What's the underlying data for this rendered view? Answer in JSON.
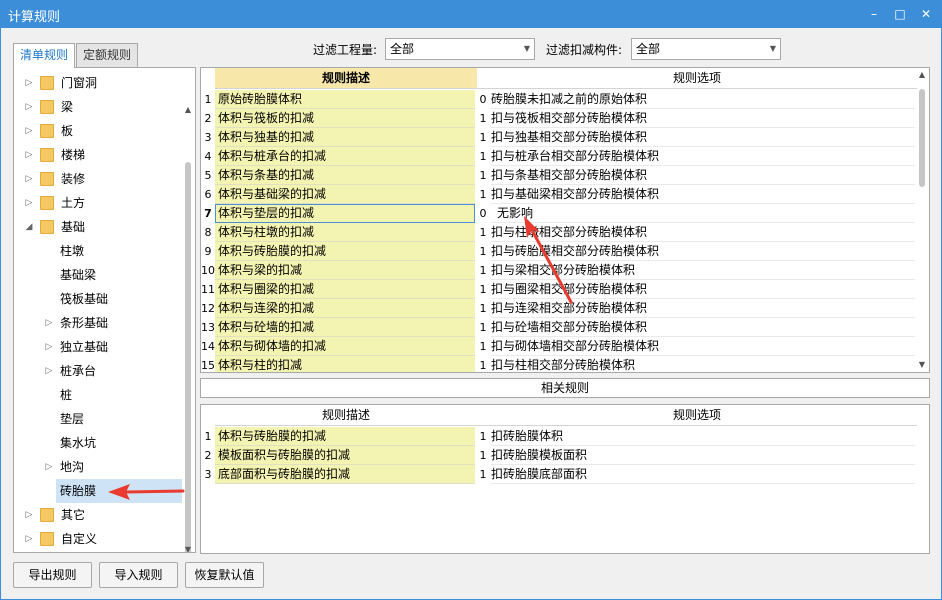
{
  "window": {
    "title": "计算规则",
    "minimize": "–",
    "maximize": "□",
    "close": "✕"
  },
  "tabs": [
    {
      "label": "清单规则"
    },
    {
      "label": "定额规则"
    }
  ],
  "tree": [
    {
      "label": "门窗洞",
      "caret": "▷",
      "folder": true
    },
    {
      "label": "梁",
      "caret": "▷",
      "folder": true
    },
    {
      "label": "板",
      "caret": "▷",
      "folder": true
    },
    {
      "label": "楼梯",
      "caret": "▷",
      "folder": true
    },
    {
      "label": "装修",
      "caret": "▷",
      "folder": true
    },
    {
      "label": "土方",
      "caret": "▷",
      "folder": true
    },
    {
      "label": "基础",
      "caret": "◢",
      "folder": true
    },
    {
      "label": "柱墩",
      "caret": "",
      "folder": false
    },
    {
      "label": "基础梁",
      "caret": "",
      "folder": false
    },
    {
      "label": "筏板基础",
      "caret": "",
      "folder": false
    },
    {
      "label": "条形基础",
      "caret": "▷",
      "folder": false
    },
    {
      "label": "独立基础",
      "caret": "▷",
      "folder": false
    },
    {
      "label": "桩承台",
      "caret": "▷",
      "folder": false
    },
    {
      "label": "桩",
      "caret": "",
      "folder": false
    },
    {
      "label": "垫层",
      "caret": "",
      "folder": false
    },
    {
      "label": "集水坑",
      "caret": "",
      "folder": false
    },
    {
      "label": "地沟",
      "caret": "▷",
      "folder": false
    },
    {
      "label": "砖胎膜",
      "caret": "",
      "folder": false
    },
    {
      "label": "其它",
      "caret": "▷",
      "folder": true
    },
    {
      "label": "自定义",
      "caret": "▷",
      "folder": true
    }
  ],
  "filters": {
    "project_label": "过滤工程量:",
    "project_value": "全部",
    "deduct_label": "过滤扣减构件:",
    "deduct_value": "全部"
  },
  "main_grid": {
    "col_desc": "规则描述",
    "col_opt": "规则选项",
    "rows": [
      {
        "num": "1",
        "desc": "原始砖胎膜体积",
        "code": "0",
        "opt": "砖胎膜未扣减之前的原始体积"
      },
      {
        "num": "2",
        "desc": "体积与筏板的扣减",
        "code": "1",
        "opt": "扣与筏板相交部分砖胎模体积"
      },
      {
        "num": "3",
        "desc": "体积与独基的扣减",
        "code": "1",
        "opt": "扣与独基相交部分砖胎模体积"
      },
      {
        "num": "4",
        "desc": "体积与桩承台的扣减",
        "code": "1",
        "opt": "扣与桩承台相交部分砖胎模体积"
      },
      {
        "num": "5",
        "desc": "体积与条基的扣减",
        "code": "1",
        "opt": "扣与条基相交部分砖胎模体积"
      },
      {
        "num": "6",
        "desc": "体积与基础梁的扣减",
        "code": "1",
        "opt": "扣与基础梁相交部分砖胎模体积"
      },
      {
        "num": "7",
        "desc": "体积与垫层的扣减",
        "code": "0",
        "opt": "无影响"
      },
      {
        "num": "8",
        "desc": "体积与柱墩的扣减",
        "code": "1",
        "opt": "扣与柱墩相交部分砖胎模体积"
      },
      {
        "num": "9",
        "desc": "体积与砖胎膜的扣减",
        "code": "1",
        "opt": "扣与砖胎膜相交部分砖胎模体积"
      },
      {
        "num": "10",
        "desc": "体积与梁的扣减",
        "code": "1",
        "opt": "扣与梁相交部分砖胎模体积"
      },
      {
        "num": "11",
        "desc": "体积与圈梁的扣减",
        "code": "1",
        "opt": "扣与圈梁相交部分砖胎模体积"
      },
      {
        "num": "12",
        "desc": "体积与连梁的扣减",
        "code": "1",
        "opt": "扣与连梁相交部分砖胎模体积"
      },
      {
        "num": "13",
        "desc": "体积与砼墙的扣减",
        "code": "1",
        "opt": "扣与砼墙相交部分砖胎模体积"
      },
      {
        "num": "14",
        "desc": "体积与砌体墙的扣减",
        "code": "1",
        "opt": "扣与砌体墙相交部分砖胎模体积"
      },
      {
        "num": "15",
        "desc": "体积与柱的扣减",
        "code": "1",
        "opt": "扣与柱相交部分砖胎模体积"
      }
    ]
  },
  "related": {
    "title": "相关规则",
    "col_desc": "规则描述",
    "col_opt": "规则选项",
    "rows": [
      {
        "num": "1",
        "desc": "体积与砖胎膜的扣减",
        "code": "1",
        "opt": "扣砖胎膜体积"
      },
      {
        "num": "2",
        "desc": "模板面积与砖胎膜的扣减",
        "code": "1",
        "opt": "扣砖胎膜模板面积"
      },
      {
        "num": "3",
        "desc": "底部面积与砖胎膜的扣减",
        "code": "1",
        "opt": "扣砖胎膜底部面积"
      }
    ]
  },
  "buttons": {
    "export": "导出规则",
    "import": "导入规则",
    "restore": "恢复默认值"
  },
  "scroll": {
    "up": "▲",
    "down": "▼"
  },
  "colors": {
    "titlebar": "#3c8ed8",
    "highlight_desc": "#f4f4b2",
    "arrow": "#e83a2e",
    "selected": "#cfe3f7"
  }
}
